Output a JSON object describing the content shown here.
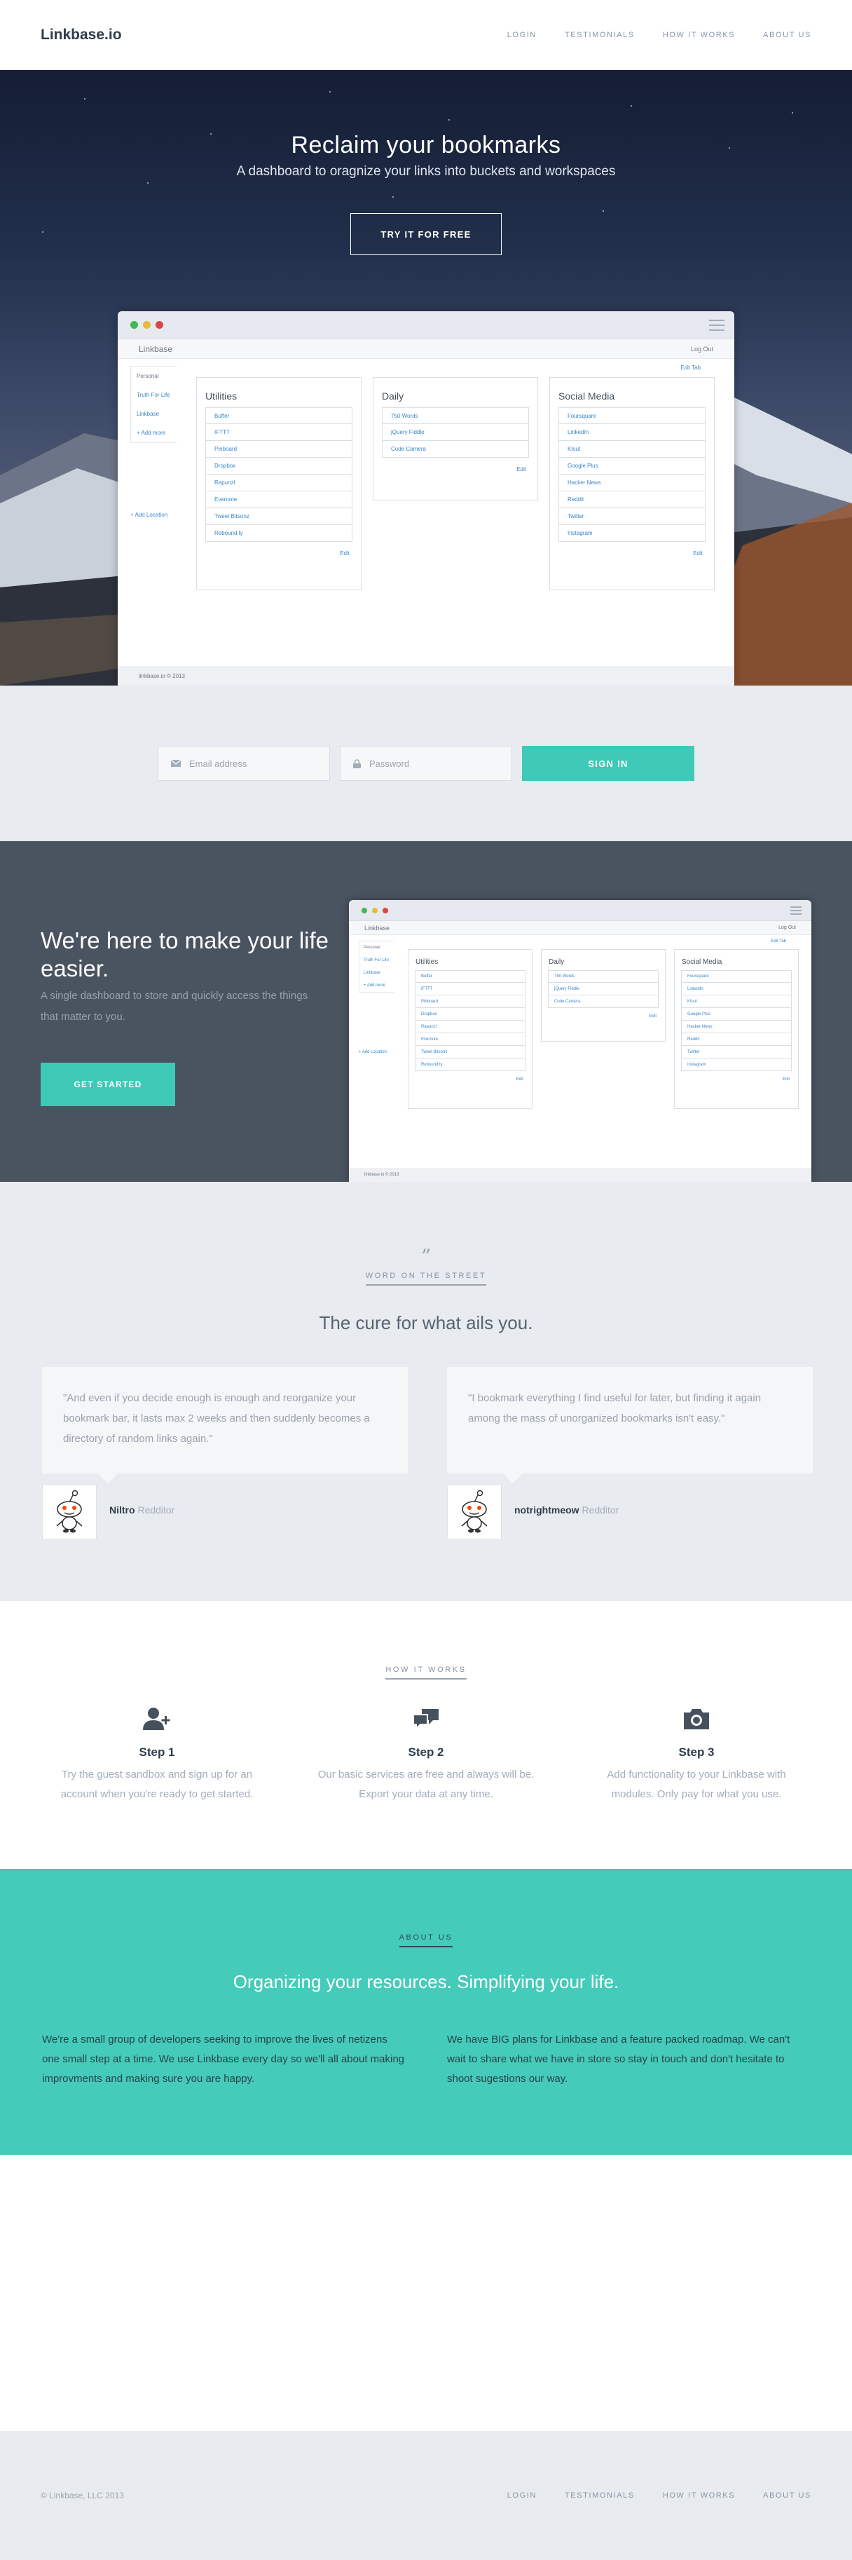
{
  "nav": {
    "brand": "Linkbase.io",
    "links": [
      "LOGIN",
      "TESTIMONIALS",
      "HOW IT WORKS",
      "ABOUT US"
    ]
  },
  "hero": {
    "title": "Reclaim your bookmarks",
    "subtitle": "A dashboard to oragnize your links into buckets and workspaces",
    "cta": "TRY IT FOR FREE"
  },
  "app": {
    "name": "Linkbase",
    "logout": "Log Out",
    "edit_tabs": "Edit Tab",
    "side_tabs": [
      "Personal",
      "Truth For Life",
      "Linkbase",
      "+ Add more"
    ],
    "add_location": "+ Add Location",
    "edit": "Edit",
    "footer": "linkbase.io © 2013",
    "buckets": [
      {
        "title": "Utilities",
        "items": [
          "Buffer",
          "IFTTT",
          "Pinboard",
          "Dropbox",
          "Rapunzl",
          "Evernote",
          "Tweet Bitsonz",
          "Rebound.ly"
        ]
      },
      {
        "title": "Daily",
        "items": [
          "750 Words",
          "jQuery Fiddle",
          "Code Camera"
        ]
      },
      {
        "title": "Social Media",
        "items": [
          "Foursquare",
          "LinkedIn",
          "Klout",
          "Google Plus",
          "Hacker News",
          "Reddit",
          "Twitter",
          "Instagram"
        ]
      }
    ]
  },
  "signin": {
    "email_placeholder": "Email address",
    "password_placeholder": "Password",
    "button": "SIGN IN"
  },
  "feature": {
    "title": "We're here to make your life easier.",
    "subtitle": "A single dashboard to store and quickly access the things that matter to you.",
    "button": "GET STARTED"
  },
  "testimonials": {
    "label": "WORD ON THE STREET",
    "heading": "The cure for what ails you.",
    "items": [
      {
        "quote": "\"And even if you decide enough is enough and reorganize your bookmark bar, it lasts max 2 weeks and then suddenly becomes a directory of random links again.\"",
        "name": "Niltro",
        "role": "Redditor"
      },
      {
        "quote": "\"I bookmark everything I find useful for later, but finding it again among the mass of unorganized bookmarks isn't easy.\"",
        "name": "notrightmeow",
        "role": "Redditor"
      }
    ]
  },
  "how": {
    "label": "HOW IT WORKS",
    "steps": [
      {
        "icon": "add-user-icon",
        "title": "Step 1",
        "desc": "Try the guest sandbox and sign up for an account when you're ready to get started."
      },
      {
        "icon": "chat-bubbles-icon",
        "title": "Step 2",
        "desc": "Our basic services are free and always will be. Export your data at any time."
      },
      {
        "icon": "camera-icon",
        "title": "Step 3",
        "desc": "Add functionality to your Linkbase with modules. Only pay for what you use."
      }
    ]
  },
  "about": {
    "label": "ABOUT US",
    "heading": "Organizing your resources. Simplifying your life.",
    "left": "We're a small group of developers seeking to improve the lives of netizens one small step at a time. We use Linkbase every day so we'll all about making improvments and making sure you are happy.",
    "right": "We have BIG plans for Linkbase and a feature packed roadmap. We can't wait to share what we have in store so stay in touch and don't hesitate to shoot sugestions our way."
  },
  "footer": {
    "copyright": "© Linkbase, LLC 2013",
    "links": [
      "LOGIN",
      "TESTIMONIALS",
      "HOW IT WORKS",
      "ABOUT US"
    ]
  },
  "colors": {
    "accent": "#3fcab8",
    "dark": "#4a5360",
    "link": "#3a86c8"
  }
}
